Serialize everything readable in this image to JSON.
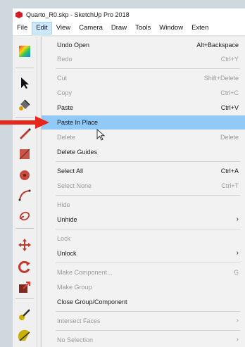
{
  "window": {
    "title": "Quarto_R0.skp - SketchUp Pro 2018"
  },
  "menubar": {
    "items": [
      "File",
      "Edit",
      "View",
      "Camera",
      "Draw",
      "Tools",
      "Window",
      "Exten"
    ],
    "active": "Edit"
  },
  "toolbar": {
    "tools": [
      "color-swatch-icon",
      "select-arrow-icon",
      "paint-bucket-icon",
      "pencil-line-icon",
      "rectangle-icon",
      "circle-icon",
      "arc-icon",
      "freehand-loop-icon",
      "move-icon",
      "rotate-icon",
      "scale-icon",
      "tape-measure-icon",
      "protractor-icon"
    ]
  },
  "edit_menu": {
    "items": [
      {
        "label": "Undo Open",
        "shortcut": "Alt+Backspace",
        "enabled": true
      },
      {
        "label": "Redo",
        "shortcut": "Ctrl+Y",
        "enabled": false
      },
      {
        "label": "Cut",
        "shortcut": "Shift+Delete",
        "enabled": false
      },
      {
        "label": "Copy",
        "shortcut": "Ctrl+C",
        "enabled": false
      },
      {
        "label": "Paste",
        "shortcut": "Ctrl+V",
        "enabled": true
      },
      {
        "label": "Paste In Place",
        "shortcut": "",
        "enabled": true,
        "highlighted": true
      },
      {
        "label": "Delete",
        "shortcut": "Delete",
        "enabled": false
      },
      {
        "label": "Delete Guides",
        "shortcut": "",
        "enabled": true
      },
      {
        "label": "Select All",
        "shortcut": "Ctrl+A",
        "enabled": true
      },
      {
        "label": "Select None",
        "shortcut": "Ctrl+T",
        "enabled": false
      },
      {
        "label": "Hide",
        "shortcut": "",
        "enabled": false
      },
      {
        "label": "Unhide",
        "shortcut": "",
        "enabled": true,
        "submenu": true
      },
      {
        "label": "Lock",
        "shortcut": "",
        "enabled": false
      },
      {
        "label": "Unlock",
        "shortcut": "",
        "enabled": true,
        "submenu": true
      },
      {
        "label": "Make Component...",
        "shortcut": "G",
        "enabled": false
      },
      {
        "label": "Make Group",
        "shortcut": "",
        "enabled": false
      },
      {
        "label": "Close Group/Component",
        "shortcut": "",
        "enabled": true
      },
      {
        "label": "Intersect Faces",
        "shortcut": "",
        "enabled": false,
        "submenu": true
      },
      {
        "label": "No Selection",
        "shortcut": "",
        "enabled": false,
        "submenu": true
      }
    ],
    "submenu_arrow": "›"
  },
  "colors": {
    "highlight": "#91c9f7",
    "annotation_arrow": "#e8261c",
    "brand": "#d11f2a"
  }
}
